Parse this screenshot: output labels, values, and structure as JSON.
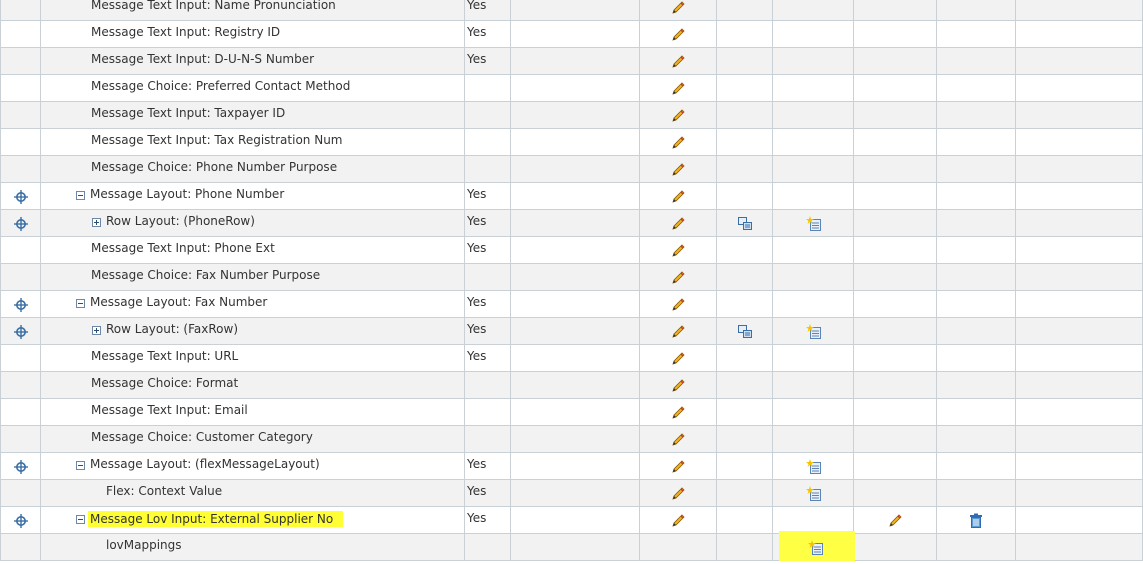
{
  "table": {
    "rows": [
      {
        "label": "Message Text Input: Name Pronunciation",
        "required": "Yes",
        "indent": 2,
        "toggle": "",
        "reorder": false,
        "update": true,
        "personalize": false,
        "create": false,
        "edit2": false,
        "delete": false
      },
      {
        "label": "Message Text Input: Registry ID",
        "required": "Yes",
        "indent": 2,
        "toggle": "",
        "reorder": false,
        "update": true,
        "personalize": false,
        "create": false,
        "edit2": false,
        "delete": false
      },
      {
        "label": "Message Text Input: D-U-N-S Number",
        "required": "Yes",
        "indent": 2,
        "toggle": "",
        "reorder": false,
        "update": true,
        "personalize": false,
        "create": false,
        "edit2": false,
        "delete": false
      },
      {
        "label": "Message Choice: Preferred Contact Method",
        "required": "",
        "indent": 2,
        "toggle": "",
        "reorder": false,
        "update": true,
        "personalize": false,
        "create": false,
        "edit2": false,
        "delete": false
      },
      {
        "label": "Message Text Input: Taxpayer ID",
        "required": "",
        "indent": 2,
        "toggle": "",
        "reorder": false,
        "update": true,
        "personalize": false,
        "create": false,
        "edit2": false,
        "delete": false
      },
      {
        "label": "Message Text Input: Tax Registration Num",
        "required": "",
        "indent": 2,
        "toggle": "",
        "reorder": false,
        "update": true,
        "personalize": false,
        "create": false,
        "edit2": false,
        "delete": false
      },
      {
        "label": "Message Choice: Phone Number Purpose",
        "required": "",
        "indent": 2,
        "toggle": "",
        "reorder": false,
        "update": true,
        "personalize": false,
        "create": false,
        "edit2": false,
        "delete": false
      },
      {
        "label": "Message Layout: Phone Number",
        "required": "Yes",
        "indent": 1,
        "toggle": "minus",
        "reorder": true,
        "update": true,
        "personalize": false,
        "create": false,
        "edit2": false,
        "delete": false
      },
      {
        "label": "Row Layout: (PhoneRow)",
        "required": "Yes",
        "indent": 2,
        "toggle": "plus",
        "reorder": true,
        "update": true,
        "personalize": true,
        "create": true,
        "edit2": false,
        "delete": false
      },
      {
        "label": "Message Text Input: Phone Ext",
        "required": "Yes",
        "indent": 2,
        "toggle": "",
        "reorder": false,
        "update": true,
        "personalize": false,
        "create": false,
        "edit2": false,
        "delete": false
      },
      {
        "label": "Message Choice: Fax Number Purpose",
        "required": "",
        "indent": 2,
        "toggle": "",
        "reorder": false,
        "update": true,
        "personalize": false,
        "create": false,
        "edit2": false,
        "delete": false
      },
      {
        "label": "Message Layout: Fax Number",
        "required": "Yes",
        "indent": 1,
        "toggle": "minus",
        "reorder": true,
        "update": true,
        "personalize": false,
        "create": false,
        "edit2": false,
        "delete": false
      },
      {
        "label": "Row Layout: (FaxRow)",
        "required": "Yes",
        "indent": 2,
        "toggle": "plus",
        "reorder": true,
        "update": true,
        "personalize": true,
        "create": true,
        "edit2": false,
        "delete": false
      },
      {
        "label": "Message Text Input: URL",
        "required": "Yes",
        "indent": 2,
        "toggle": "",
        "reorder": false,
        "update": true,
        "personalize": false,
        "create": false,
        "edit2": false,
        "delete": false
      },
      {
        "label": "Message Choice: Format",
        "required": "",
        "indent": 2,
        "toggle": "",
        "reorder": false,
        "update": true,
        "personalize": false,
        "create": false,
        "edit2": false,
        "delete": false
      },
      {
        "label": "Message Text Input: Email",
        "required": "",
        "indent": 2,
        "toggle": "",
        "reorder": false,
        "update": true,
        "personalize": false,
        "create": false,
        "edit2": false,
        "delete": false
      },
      {
        "label": "Message Choice: Customer Category",
        "required": "",
        "indent": 2,
        "toggle": "",
        "reorder": false,
        "update": true,
        "personalize": false,
        "create": false,
        "edit2": false,
        "delete": false
      },
      {
        "label": "Message Layout: (flexMessageLayout)",
        "required": "Yes",
        "indent": 1,
        "toggle": "minus",
        "reorder": true,
        "update": true,
        "personalize": false,
        "create": true,
        "edit2": false,
        "delete": false
      },
      {
        "label": "Flex: Context Value",
        "required": "Yes",
        "indent": 3,
        "toggle": "",
        "reorder": false,
        "update": true,
        "personalize": false,
        "create": true,
        "edit2": false,
        "delete": false
      },
      {
        "label": "Message Lov Input: External Supplier No",
        "required": "Yes",
        "indent": 1,
        "toggle": "minus",
        "reorder": true,
        "update": true,
        "personalize": false,
        "create": false,
        "edit2": true,
        "delete": true,
        "highlight": true
      },
      {
        "label": "lovMappings",
        "required": "",
        "indent": 3,
        "toggle": "",
        "reorder": false,
        "update": false,
        "personalize": false,
        "create": true,
        "edit2": false,
        "delete": false,
        "highlightCreate": true
      }
    ],
    "icons": {
      "reorder": "move-target-icon",
      "update": "pencil-edit-icon",
      "personalize": "personalize-icon",
      "create": "create-item-icon",
      "delete": "trash-delete-icon"
    },
    "colors": {
      "highlight": "#ffff33",
      "row_alt": "#f2f2f2",
      "grid": "#c9d0d6"
    }
  }
}
